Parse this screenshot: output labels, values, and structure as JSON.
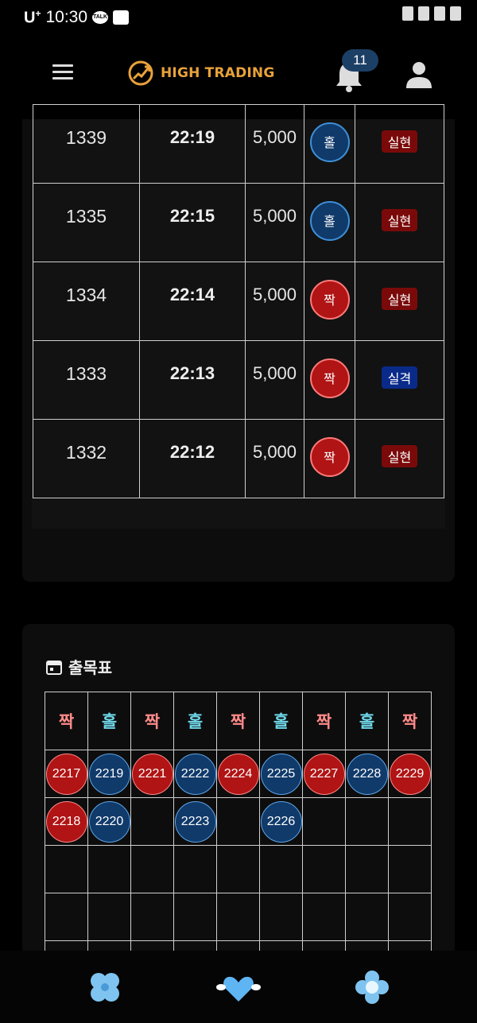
{
  "status_bar": {
    "carrier": "U",
    "carrier_sup": "+",
    "time": "10:30",
    "talk_icon_text": "TALK"
  },
  "header": {
    "brand": "HIGH TRADING",
    "notification_count": "11",
    "brand_color": "#e8a23a"
  },
  "results": {
    "rows": [
      {
        "round": "1339",
        "time": "22:19",
        "amount": "5,000",
        "pick": "홀",
        "pick_type": "odd",
        "result": "실현",
        "result_type": "hit"
      },
      {
        "round": "1335",
        "time": "22:15",
        "amount": "5,000",
        "pick": "홀",
        "pick_type": "odd",
        "result": "실현",
        "result_type": "hit"
      },
      {
        "round": "1334",
        "time": "22:14",
        "amount": "5,000",
        "pick": "짝",
        "pick_type": "even",
        "result": "실현",
        "result_type": "hit"
      },
      {
        "round": "1333",
        "time": "22:13",
        "amount": "5,000",
        "pick": "짝",
        "pick_type": "even",
        "result": "실격",
        "result_type": "miss"
      },
      {
        "round": "1332",
        "time": "22:12",
        "amount": "5,000",
        "pick": "짝",
        "pick_type": "even",
        "result": "실현",
        "result_type": "hit"
      }
    ]
  },
  "chart": {
    "title": "출목표",
    "columns": [
      {
        "label": "짝",
        "type": "even",
        "values": [
          "2217",
          "2218"
        ]
      },
      {
        "label": "홀",
        "type": "odd",
        "values": [
          "2219",
          "2220"
        ]
      },
      {
        "label": "짝",
        "type": "even",
        "values": [
          "2221"
        ]
      },
      {
        "label": "홀",
        "type": "odd",
        "values": [
          "2222",
          "2223"
        ]
      },
      {
        "label": "짝",
        "type": "even",
        "values": [
          "2224"
        ]
      },
      {
        "label": "홀",
        "type": "odd",
        "values": [
          "2225",
          "2226"
        ]
      },
      {
        "label": "짝",
        "type": "even",
        "values": [
          "2227"
        ]
      },
      {
        "label": "홀",
        "type": "odd",
        "values": [
          "2228"
        ]
      },
      {
        "label": "짝",
        "type": "even",
        "values": [
          "2229"
        ]
      }
    ],
    "empty_rows": 3
  },
  "colors": {
    "even": "#b01414",
    "odd": "#103a6a",
    "hit": "#7a0a0a",
    "miss": "#0a2a8a"
  },
  "nav": {
    "items": [
      "clover-icon",
      "heart-wings-icon",
      "flower-icon"
    ]
  }
}
